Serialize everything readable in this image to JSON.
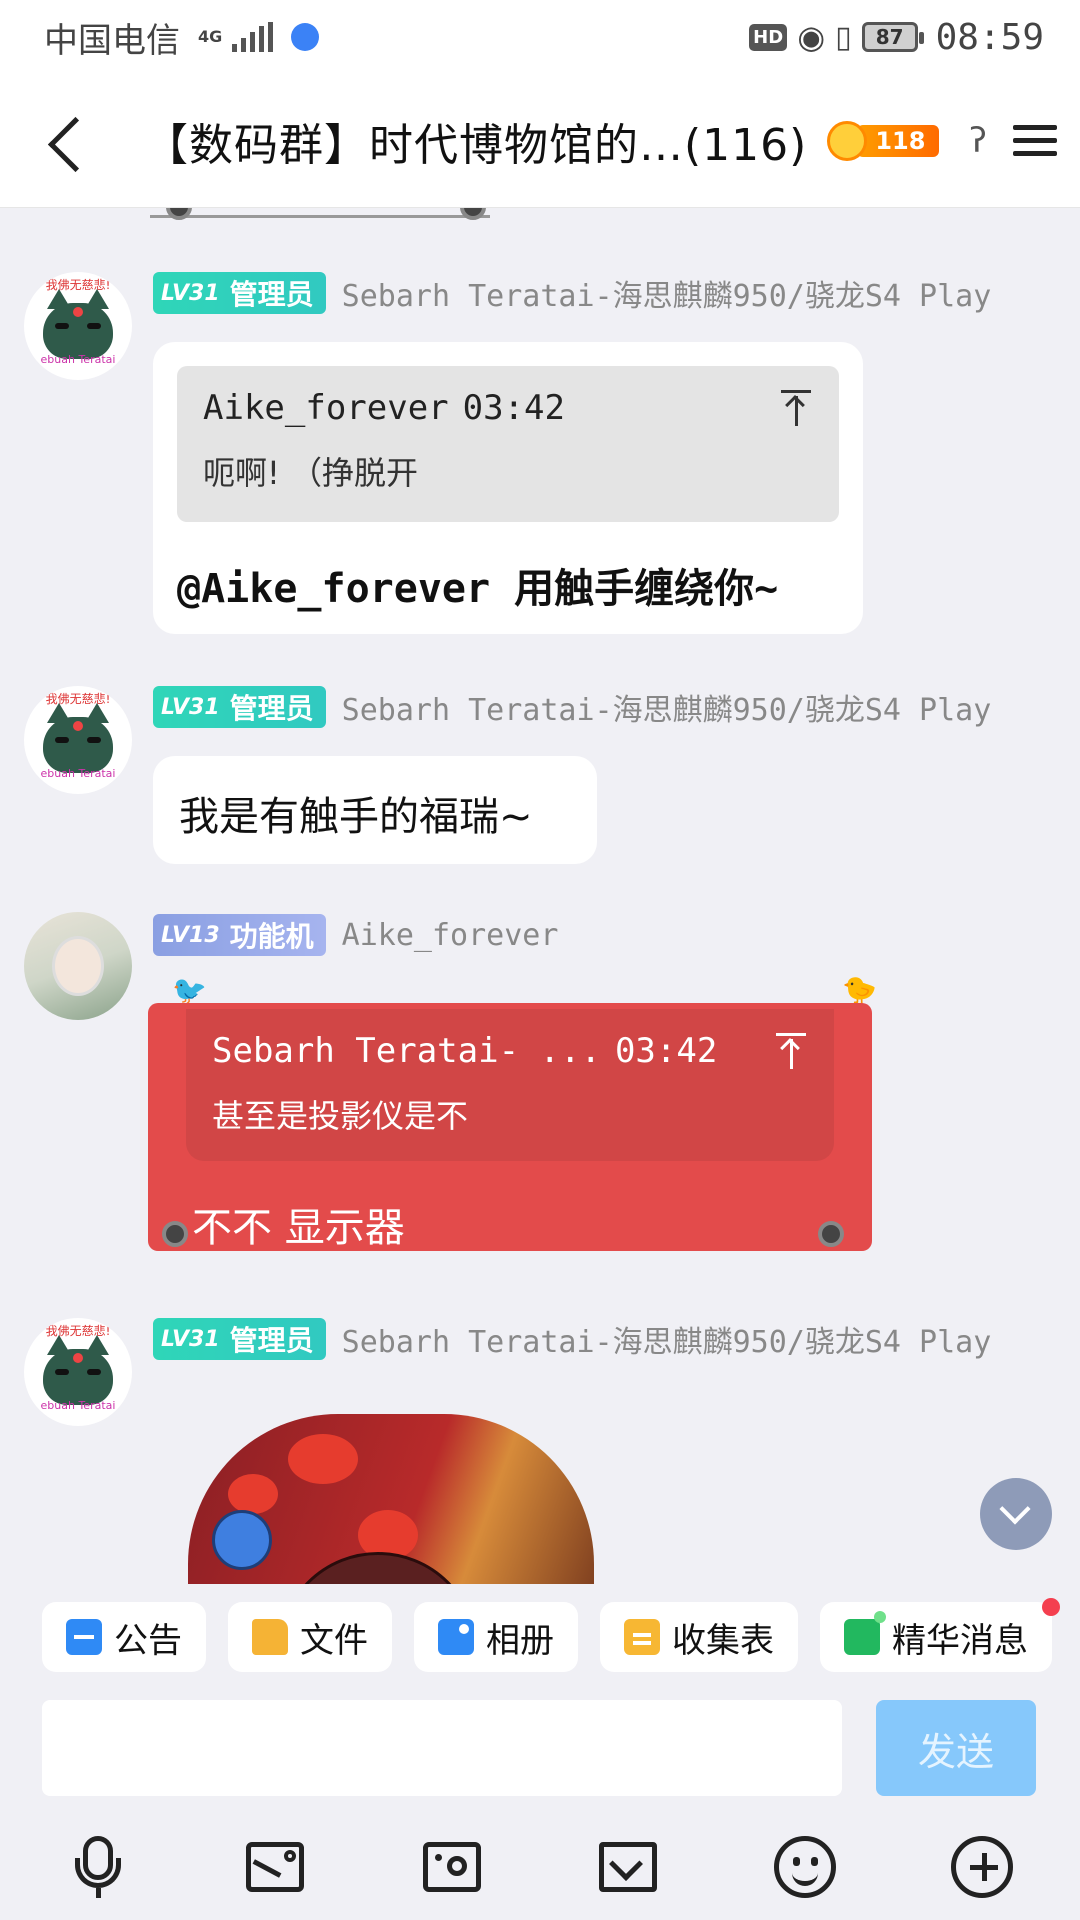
{
  "status_bar": {
    "carrier": "中国电信",
    "network": "4G",
    "hd": "HD",
    "battery": "87",
    "time": "08:59"
  },
  "header": {
    "title": "【数码群】时代博物馆的…(116)",
    "fire_count": "118"
  },
  "messages": [
    {
      "level": "LV31",
      "role": "管理员",
      "sender": "Sebarh Teratai-海思麒麟950/骁龙S4 Play",
      "avatar_top_text": "我佛无慈悲!",
      "avatar_bottom_text": "ebuah Teratai",
      "quote_author": "Aike_forever",
      "quote_time": "03:42",
      "quote_text": "呃啊! （挣脱开",
      "text": "@Aike_forever 用触手缠绕你~"
    },
    {
      "level": "LV31",
      "role": "管理员",
      "sender": "Sebarh Teratai-海思麒麟950/骁龙S4 Play",
      "avatar_top_text": "我佛无慈悲!",
      "avatar_bottom_text": "ebuah Teratai",
      "text": "我是有触手的福瑞~"
    },
    {
      "level": "LV13",
      "role": "功能机",
      "sender": "Aike_forever",
      "quote_author": "Sebarh Teratai- ...",
      "quote_time": "03:42",
      "quote_text": "甚至是投影仪是不",
      "text": "不不  显示器"
    },
    {
      "level": "LV31",
      "role": "管理员",
      "sender": "Sebarh Teratai-海思麒麟950/骁龙S4 Play",
      "avatar_top_text": "我佛无慈悲!",
      "avatar_bottom_text": "ebuah Teratai"
    }
  ],
  "quickbar": {
    "items": [
      {
        "label": "公告",
        "icon": "announcement-icon"
      },
      {
        "label": "文件",
        "icon": "folder-icon"
      },
      {
        "label": "相册",
        "icon": "album-icon"
      },
      {
        "label": "收集表",
        "icon": "form-icon"
      },
      {
        "label": "精华消息",
        "icon": "essence-icon"
      }
    ]
  },
  "input": {
    "placeholder": "",
    "send_label": "发送"
  },
  "colors": {
    "admin_badge": "#2fd6b8",
    "func_badge": "#8a9fe2",
    "red_bubble": "#e34b4b",
    "send_disabled": "#86c8fb"
  }
}
